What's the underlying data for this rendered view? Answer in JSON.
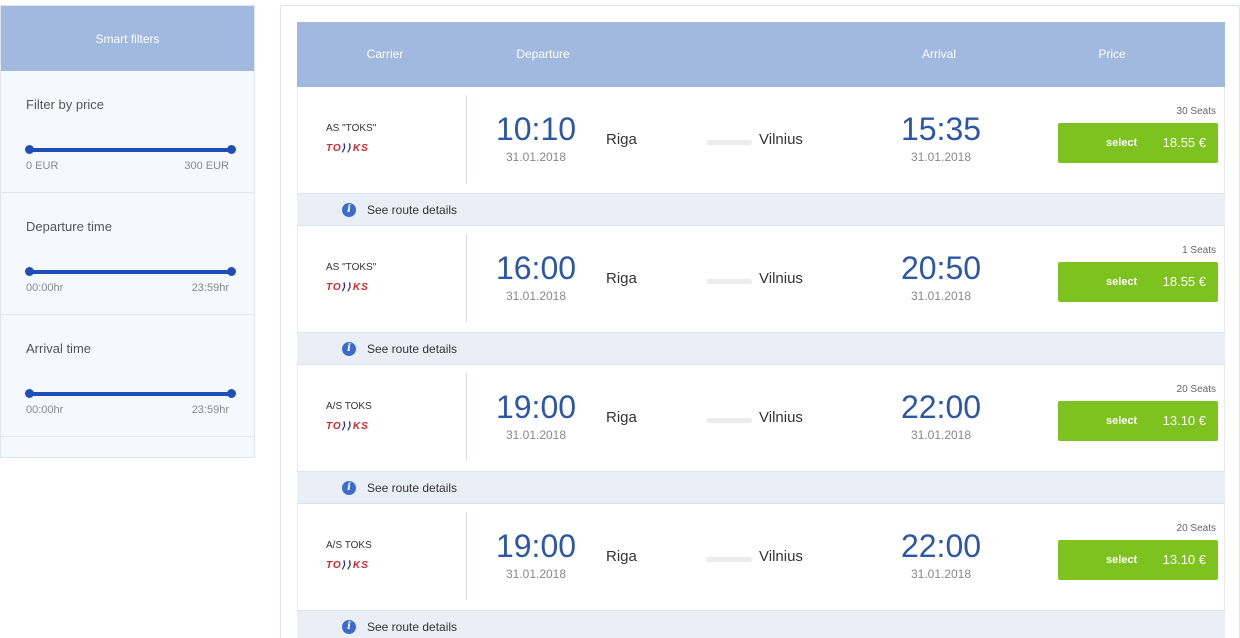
{
  "sidebar": {
    "title": "Smart filters",
    "filters": [
      {
        "title": "Filter by price",
        "min_label": "0 EUR",
        "max_label": "300 EUR"
      },
      {
        "title": "Departure time",
        "min_label": "00:00hr",
        "max_label": "23:59hr"
      },
      {
        "title": "Arrival time",
        "min_label": "00:00hr",
        "max_label": "23:59hr"
      }
    ]
  },
  "table": {
    "headers": {
      "carrier": "Carrier",
      "departure": "Departure",
      "arrival": "Arrival",
      "price": "Price"
    }
  },
  "logo": {
    "left": "TO",
    "mid": "⟩⟩",
    "right": "KS"
  },
  "trips": [
    {
      "carrier": "AS \"TOKS\"",
      "dep_time": "10:10",
      "dep_date": "31.01.2018",
      "dep_city": "Riga",
      "arr_city": "Vilnius",
      "arr_time": "15:35",
      "arr_date": "31.01.2018",
      "seats": "30 Seats",
      "select_label": "select",
      "price": "18.55 €",
      "details": "See route details"
    },
    {
      "carrier": "AS \"TOKS\"",
      "dep_time": "16:00",
      "dep_date": "31.01.2018",
      "dep_city": "Riga",
      "arr_city": "Vilnius",
      "arr_time": "20:50",
      "arr_date": "31.01.2018",
      "seats": "1 Seats",
      "select_label": "select",
      "price": "18.55 €",
      "details": "See route details"
    },
    {
      "carrier": "A/S TOKS",
      "dep_time": "19:00",
      "dep_date": "31.01.2018",
      "dep_city": "Riga",
      "arr_city": "Vilnius",
      "arr_time": "22:00",
      "arr_date": "31.01.2018",
      "seats": "20 Seats",
      "select_label": "select",
      "price": "13.10 €",
      "details": "See route details"
    },
    {
      "carrier": "A/S TOKS",
      "dep_time": "19:00",
      "dep_date": "31.01.2018",
      "dep_city": "Riga",
      "arr_city": "Vilnius",
      "arr_time": "22:00",
      "arr_date": "31.01.2018",
      "seats": "20 Seats",
      "select_label": "select",
      "price": "13.10 €",
      "details": "See route details"
    }
  ],
  "colors": {
    "header": "#a1b8df",
    "accent": "#2c56a6",
    "slider": "#1f4fb4",
    "select": "#7dc21e",
    "logo_red": "#d6262d"
  }
}
